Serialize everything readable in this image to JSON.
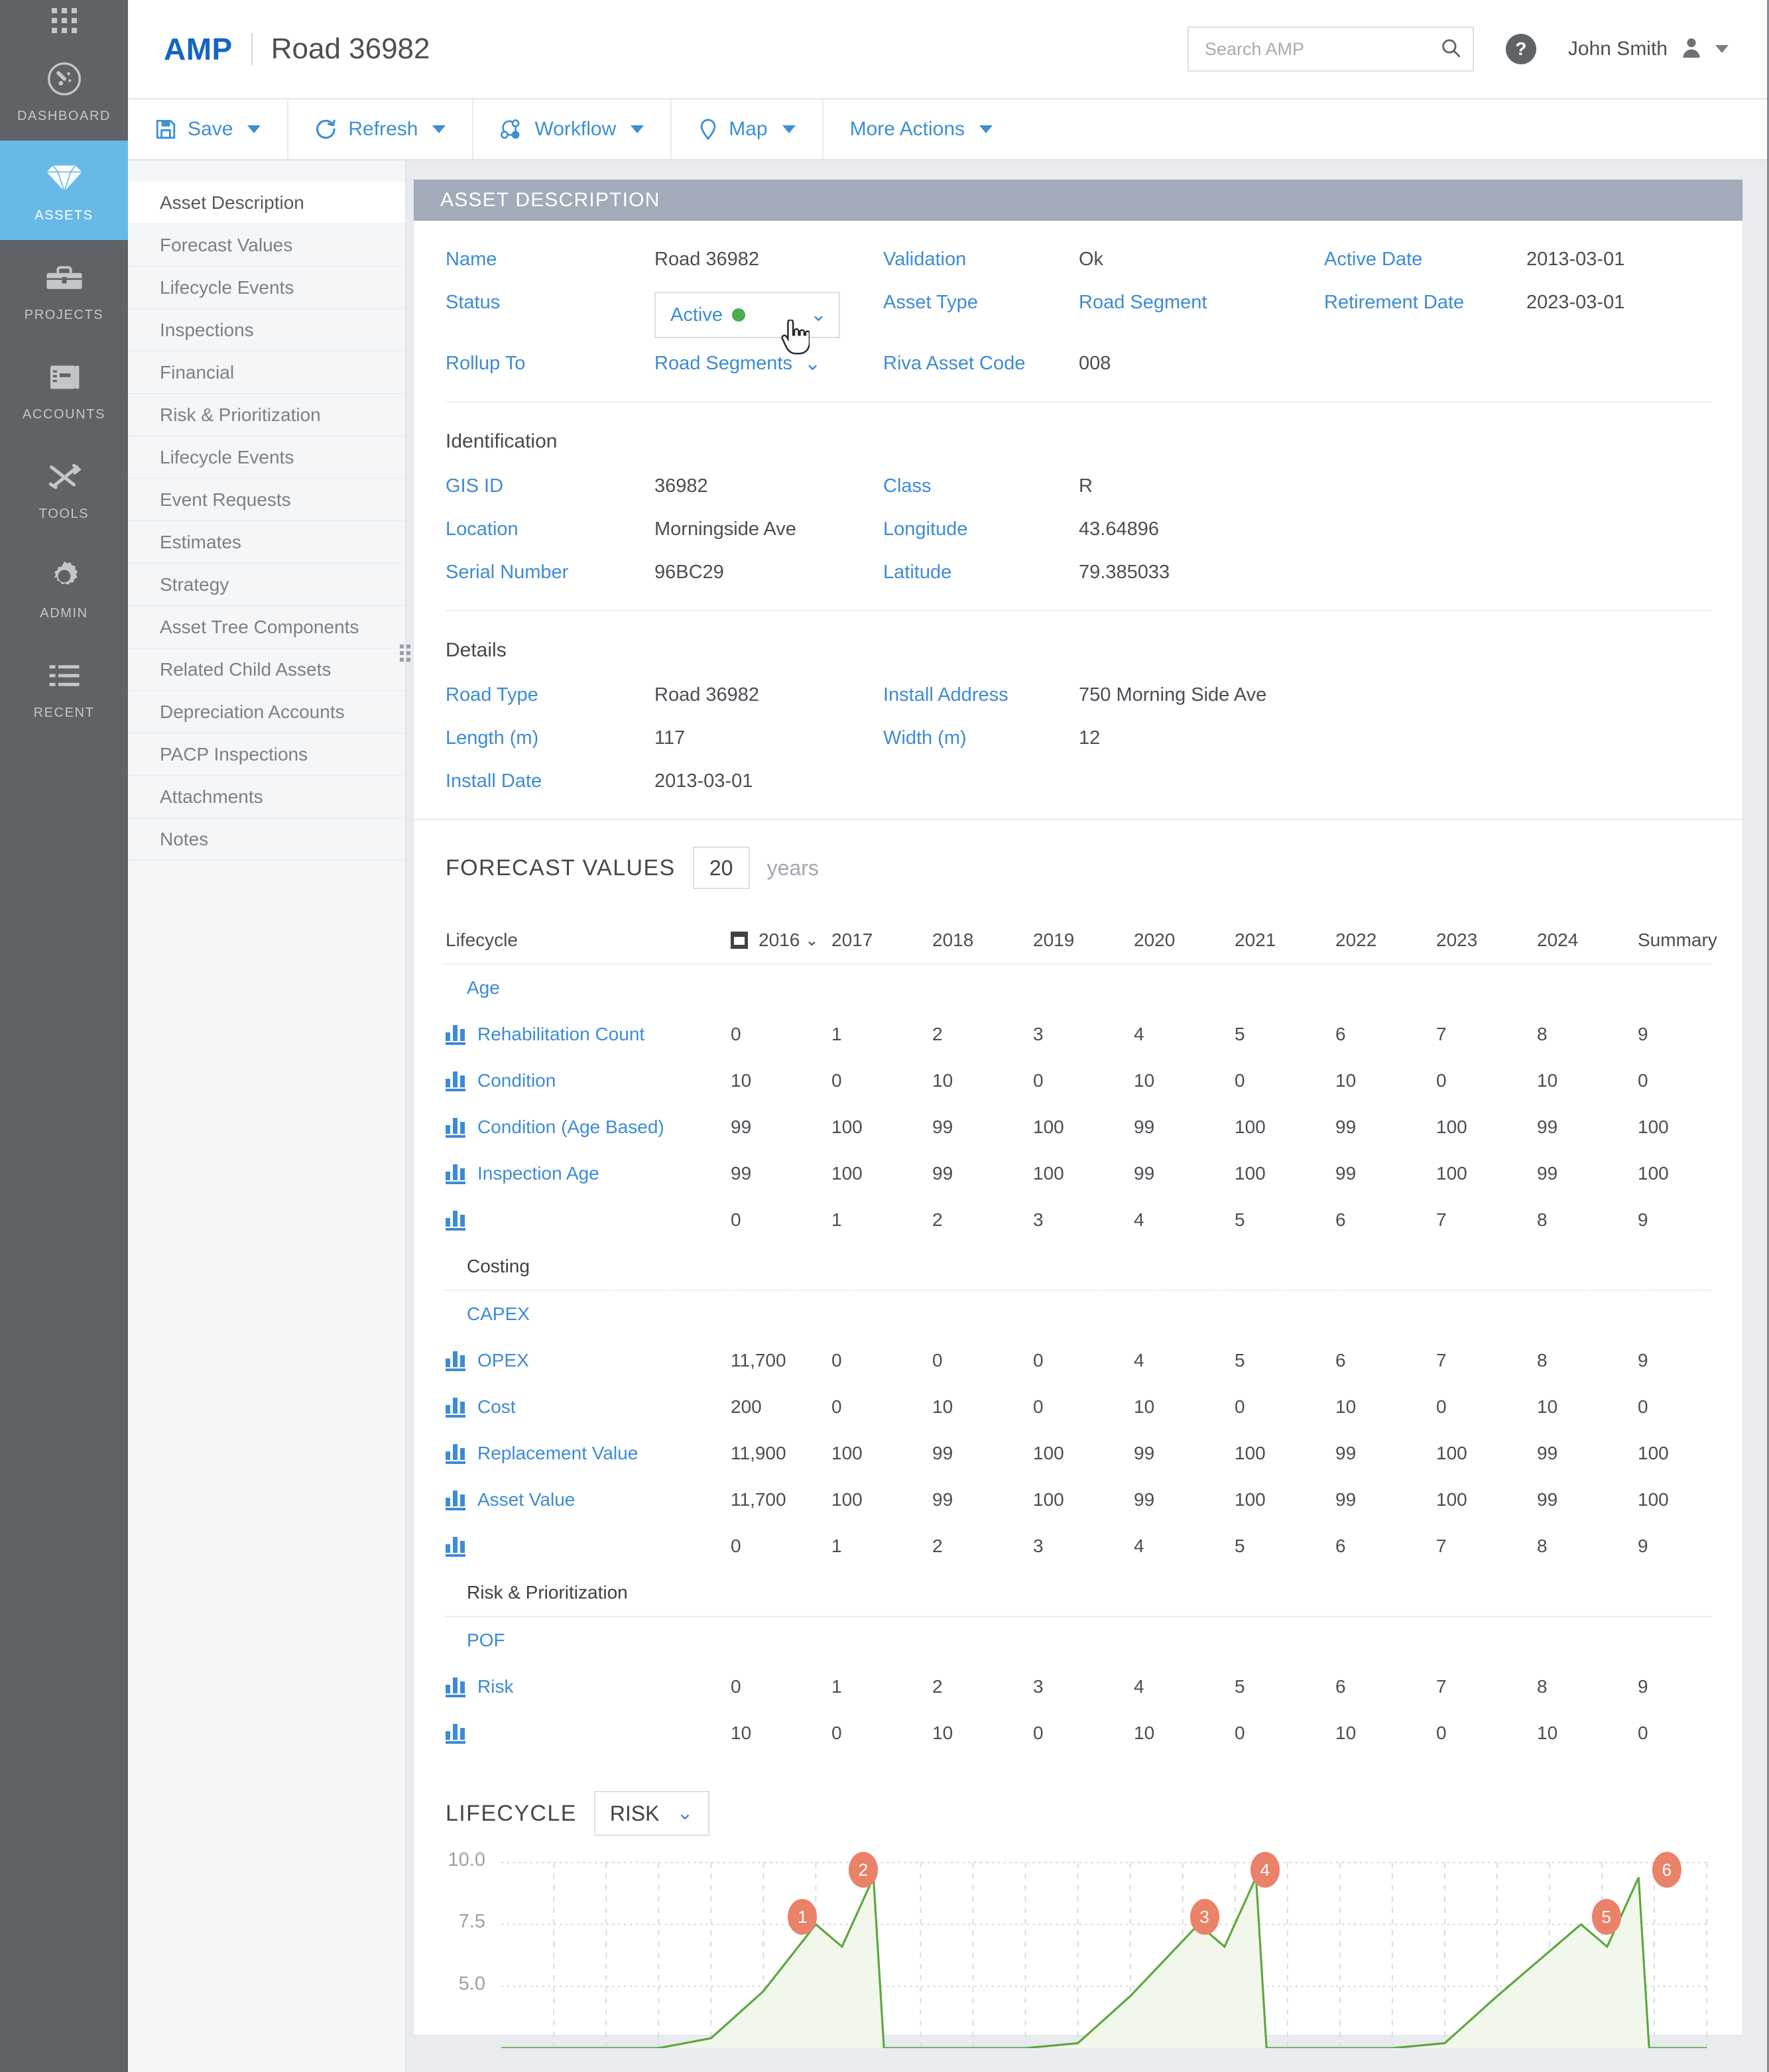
{
  "rail": {
    "app_grid": "app-grid",
    "items": [
      {
        "label": "DASHBOARD",
        "icon": "gauge-icon",
        "active": false
      },
      {
        "label": "ASSETS",
        "icon": "diamond-icon",
        "active": true
      },
      {
        "label": "PROJECTS",
        "icon": "toolbox-icon",
        "active": false
      },
      {
        "label": "ACCOUNTS",
        "icon": "notebook-icon",
        "active": false
      },
      {
        "label": "TOOLS",
        "icon": "tools-icon",
        "active": false
      },
      {
        "label": "ADMIN",
        "icon": "gear-icon",
        "active": false
      },
      {
        "label": "RECENT",
        "icon": "list-icon",
        "active": false
      }
    ]
  },
  "header": {
    "brand": "AMP",
    "title": "Road 36982",
    "search_placeholder": "Search AMP",
    "search_value": "",
    "help_glyph": "?",
    "user_name": "John Smith"
  },
  "toolbar": {
    "buttons": [
      {
        "label": "Save",
        "icon": "save-icon"
      },
      {
        "label": "Refresh",
        "icon": "refresh-icon"
      },
      {
        "label": "Workflow",
        "icon": "workflow-icon"
      },
      {
        "label": "Map",
        "icon": "map-pin-icon"
      },
      {
        "label": "More Actions",
        "icon": "none"
      }
    ]
  },
  "subnav": {
    "items": [
      {
        "label": "Asset Description",
        "active": true
      },
      {
        "label": "Forecast Values",
        "active": false
      },
      {
        "label": "Lifecycle Events",
        "active": false
      },
      {
        "label": "Inspections",
        "active": false
      },
      {
        "label": "Financial",
        "active": false
      },
      {
        "label": "Risk & Prioritization",
        "active": false
      },
      {
        "label": "Lifecycle Events",
        "active": false
      },
      {
        "label": "Event Requests",
        "active": false
      },
      {
        "label": "Estimates",
        "active": false
      },
      {
        "label": "Strategy",
        "active": false
      },
      {
        "label": "Asset Tree Components",
        "active": false
      },
      {
        "label": "Related Child Assets",
        "active": false
      },
      {
        "label": "Depreciation Accounts",
        "active": false
      },
      {
        "label": "PACP Inspections",
        "active": false
      },
      {
        "label": "Attachments",
        "active": false
      },
      {
        "label": "Notes",
        "active": false
      }
    ]
  },
  "asset_description": {
    "panel_title": "ASSET DESCRIPTION",
    "name_label": "Name",
    "name_value": "Road 36982",
    "validation_label": "Validation",
    "validation_value": "Ok",
    "active_date_label": "Active Date",
    "active_date_value": "2013-03-01",
    "status_label": "Status",
    "status_value": "Active",
    "status_dot_color": "#4bae4f",
    "asset_type_label": "Asset Type",
    "asset_type_value": "Road Segment",
    "retirement_date_label": "Retirement Date",
    "retirement_date_value": "2023-03-01",
    "rollup_to_label": "Rollup To",
    "rollup_to_value": "Road Segments",
    "riva_asset_code_label": "Riva Asset Code",
    "riva_asset_code_value": "008"
  },
  "identification": {
    "title": "Identification",
    "gis_id_label": "GIS ID",
    "gis_id_value": "36982",
    "class_label": "Class",
    "class_value": "R",
    "location_label": "Location",
    "location_value": "Morningside Ave",
    "longitude_label": "Longitude",
    "longitude_value": "43.64896",
    "serial_number_label": "Serial Number",
    "serial_number_value": "96BC29",
    "latitude_label": "Latitude",
    "latitude_value": "79.385033"
  },
  "details": {
    "title": "Details",
    "road_type_label": "Road Type",
    "road_type_value": "Road 36982",
    "install_address_label": "Install Address",
    "install_address_value": "750 Morning Side Ave",
    "length_label": "Length (m)",
    "length_value": "117",
    "width_label": "Width (m)",
    "width_value": "12",
    "install_date_label": "Install Date",
    "install_date_value": "2013-03-01"
  },
  "forecast": {
    "title": "FORECAST VALUES",
    "years_value": "20",
    "years_label": "years",
    "col_lifecycle": "Lifecycle",
    "col_summary": "Summary",
    "first_year": "2016",
    "columns": [
      "2016",
      "2017",
      "2018",
      "2019",
      "2020",
      "2021",
      "2022",
      "2023",
      "2024"
    ],
    "rows": [
      {
        "kind": "group",
        "label": "Age",
        "style": "link",
        "values": []
      },
      {
        "kind": "data",
        "label": "Rehabilitation Count",
        "values": [
          "0",
          "1",
          "2",
          "3",
          "4",
          "5",
          "6",
          "7",
          "8"
        ],
        "summary": "9"
      },
      {
        "kind": "data",
        "label": "Condition",
        "values": [
          "10",
          "0",
          "10",
          "0",
          "10",
          "0",
          "10",
          "0",
          "10"
        ],
        "summary": "0"
      },
      {
        "kind": "data",
        "label": "Condition (Age Based)",
        "values": [
          "99",
          "100",
          "99",
          "100",
          "99",
          "100",
          "99",
          "100",
          "99"
        ],
        "summary": "100"
      },
      {
        "kind": "data",
        "label": "Inspection Age",
        "values": [
          "99",
          "100",
          "99",
          "100",
          "99",
          "100",
          "99",
          "100",
          "99"
        ],
        "summary": "100"
      },
      {
        "kind": "data",
        "label": "",
        "values": [
          "0",
          "1",
          "2",
          "3",
          "4",
          "5",
          "6",
          "7",
          "8"
        ],
        "summary": "9"
      },
      {
        "kind": "group",
        "label": "Costing",
        "style": "plain",
        "values": []
      },
      {
        "kind": "group",
        "label": "CAPEX",
        "style": "link",
        "values": []
      },
      {
        "kind": "data",
        "label": "OPEX",
        "values": [
          "11,700",
          "0",
          "0",
          "0",
          "4",
          "5",
          "6",
          "7",
          "8"
        ],
        "summary": "9"
      },
      {
        "kind": "data",
        "label": "Cost",
        "values": [
          "200",
          "0",
          "10",
          "0",
          "10",
          "0",
          "10",
          "0",
          "10"
        ],
        "summary": "0"
      },
      {
        "kind": "data",
        "label": "Replacement Value",
        "values": [
          "11,900",
          "100",
          "99",
          "100",
          "99",
          "100",
          "99",
          "100",
          "99"
        ],
        "summary": "100"
      },
      {
        "kind": "data",
        "label": "Asset Value",
        "values": [
          "11,700",
          "100",
          "99",
          "100",
          "99",
          "100",
          "99",
          "100",
          "99"
        ],
        "summary": "100"
      },
      {
        "kind": "data",
        "label": "",
        "values": [
          "0",
          "1",
          "2",
          "3",
          "4",
          "5",
          "6",
          "7",
          "8"
        ],
        "summary": "9"
      },
      {
        "kind": "group",
        "label": "Risk & Prioritization",
        "style": "plain",
        "values": []
      },
      {
        "kind": "group",
        "label": "POF",
        "style": "link",
        "values": []
      },
      {
        "kind": "data",
        "label": "Risk",
        "values": [
          "0",
          "1",
          "2",
          "3",
          "4",
          "5",
          "6",
          "7",
          "8"
        ],
        "summary": "9"
      },
      {
        "kind": "data",
        "label": "",
        "values": [
          "10",
          "0",
          "10",
          "0",
          "10",
          "0",
          "10",
          "0",
          "10"
        ],
        "summary": "0"
      }
    ]
  },
  "lifecycle": {
    "title": "LIFECYCLE",
    "selected": "RISK"
  },
  "chart_data": {
    "type": "area",
    "title": "LIFECYCLE",
    "series_name": "RISK",
    "line_color": "#5ca83c",
    "fill_color": "#f2f7ec",
    "marker_color": "#ea8169",
    "ylabel": "",
    "xlabel": "",
    "ylim": [
      2.5,
      10.0
    ],
    "yticks": [
      10.0,
      7.5,
      5.0
    ],
    "ytick_labels": [
      "10.0",
      "7.5",
      "5.0"
    ],
    "grid": true,
    "markers": [
      {
        "label": "1",
        "x": 6.0,
        "y": 7.5
      },
      {
        "label": "2",
        "x": 7.1,
        "y": 9.4
      },
      {
        "label": "3",
        "x": 13.3,
        "y": 7.5
      },
      {
        "label": "4",
        "x": 14.4,
        "y": 9.4
      },
      {
        "label": "5",
        "x": 20.6,
        "y": 7.5
      },
      {
        "label": "6",
        "x": 21.7,
        "y": 9.4
      }
    ],
    "x": [
      0,
      1,
      2,
      3,
      4,
      5,
      6,
      6.5,
      7.1,
      7.3,
      8,
      9,
      10,
      11,
      12,
      13.3,
      13.8,
      14.4,
      14.6,
      15,
      16,
      17,
      18,
      19,
      20.6,
      21.1,
      21.7,
      21.9,
      23
    ],
    "values": [
      2.5,
      2.5,
      2.5,
      2.5,
      2.9,
      4.8,
      7.5,
      6.6,
      9.4,
      2.5,
      2.5,
      2.5,
      2.5,
      2.7,
      4.6,
      7.5,
      6.6,
      9.4,
      2.5,
      2.5,
      2.5,
      2.5,
      2.7,
      4.6,
      7.5,
      6.6,
      9.4,
      2.5,
      2.5
    ]
  }
}
